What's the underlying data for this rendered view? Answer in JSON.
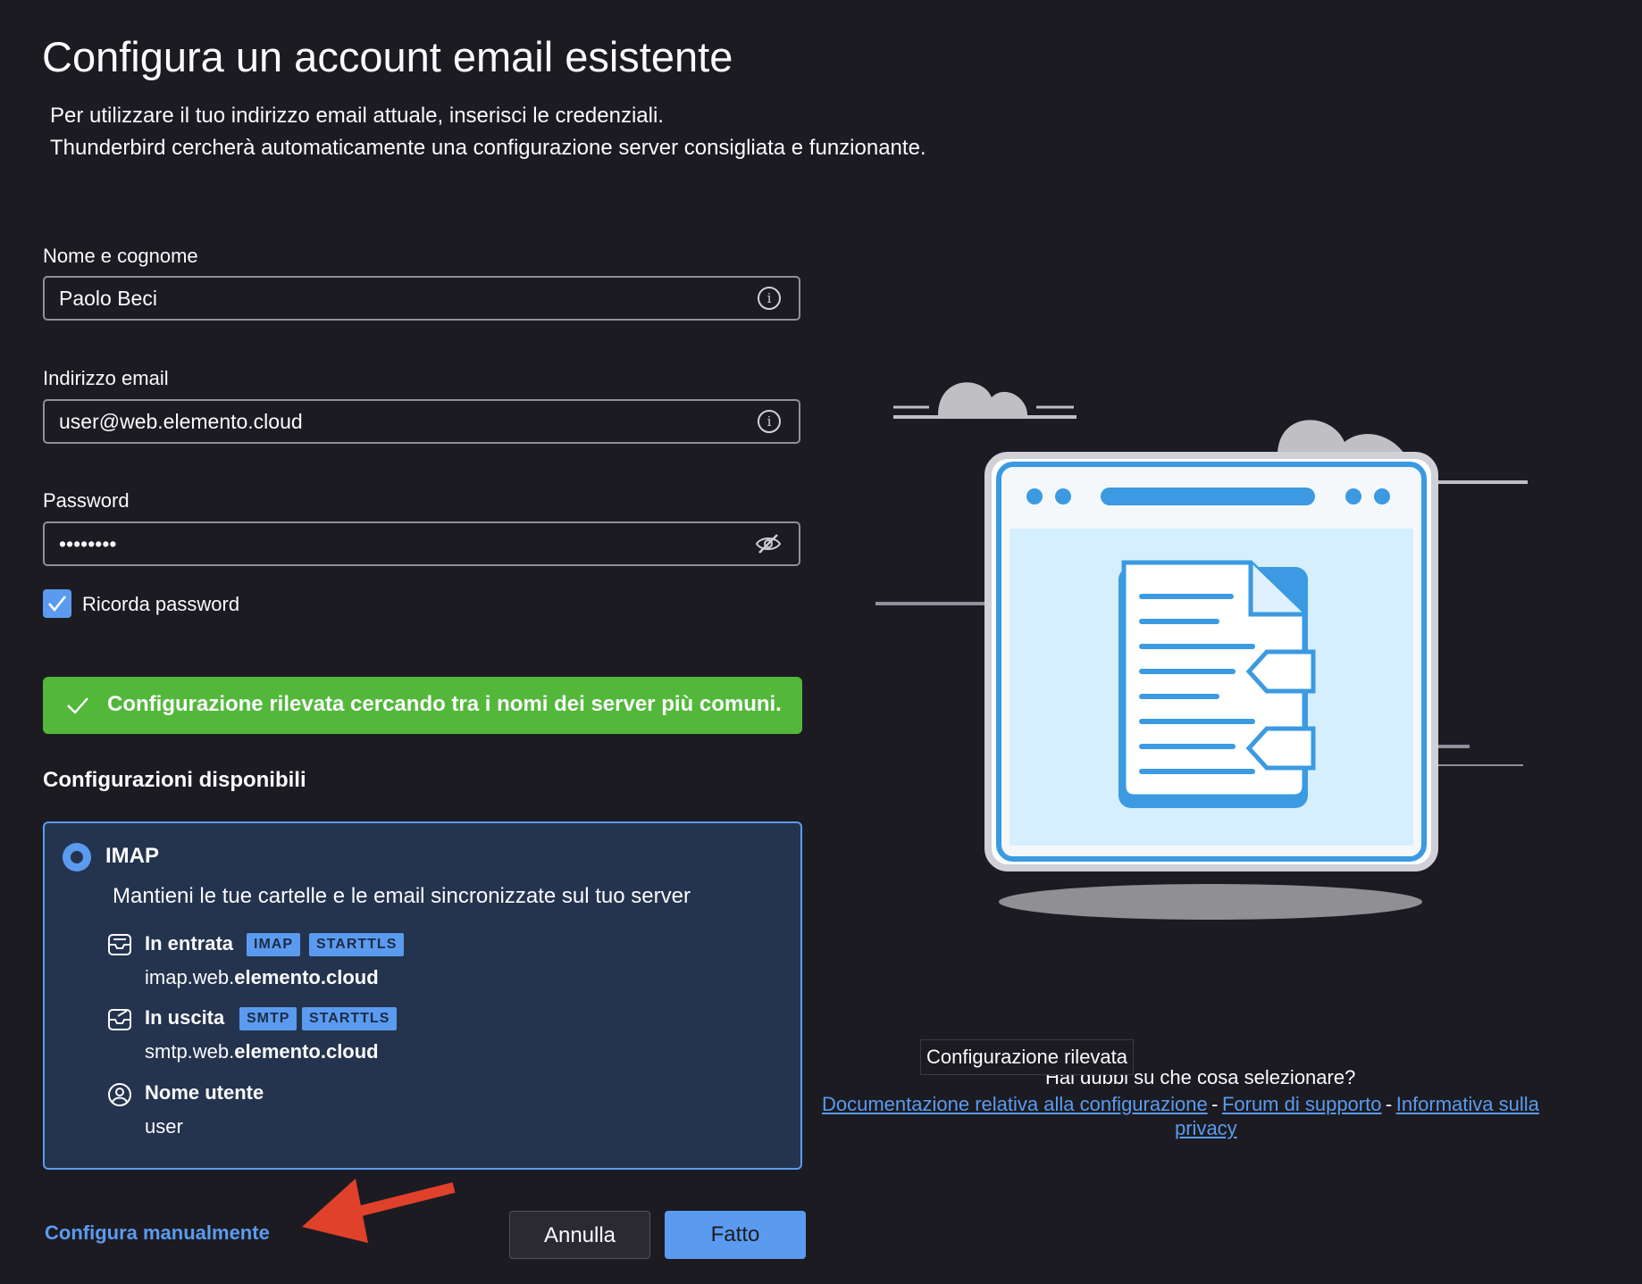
{
  "page": {
    "title": "Configura un account email esistente",
    "subtitle_line1": "Per utilizzare il tuo indirizzo email attuale, inserisci le credenziali.",
    "subtitle_line2": "Thunderbird cercherà automaticamente una configurazione server consigliata e funzionante."
  },
  "form": {
    "name_label": "Nome e cognome",
    "name_value": "Paolo Beci",
    "email_label": "Indirizzo email",
    "email_value": "user@web.elemento.cloud",
    "password_label": "Password",
    "password_value": "••••••••",
    "remember_label": "Ricorda password",
    "remember_checked": true
  },
  "status": {
    "success_message": "Configurazione rilevata cercando tra i nomi dei server più comuni.",
    "success_color": "#53b83a"
  },
  "configs": {
    "heading": "Configurazioni disponibili",
    "option": {
      "title": "IMAP",
      "description": "Mantieni le tue cartelle e le email sincronizzate sul tuo server",
      "incoming_label": "In entrata",
      "incoming_badges": [
        "IMAP",
        "STARTTLS"
      ],
      "incoming_host_prefix": "imap.web.",
      "incoming_host_domain": "elemento.cloud",
      "outgoing_label": "In uscita",
      "outgoing_badges": [
        "SMTP",
        "STARTTLS"
      ],
      "outgoing_host_prefix": "smtp.web.",
      "outgoing_host_domain": "elemento.cloud",
      "username_label": "Nome utente",
      "username_value": "user"
    }
  },
  "footer": {
    "manual_link": "Configura manualmente",
    "cancel_label": "Annulla",
    "done_label": "Fatto"
  },
  "help": {
    "tooltip": "Configurazione rilevata",
    "question": "Hai dubbi su che cosa selezionare?",
    "link_docs": "Documentazione relativa alla configurazione",
    "link_forum": "Forum di supporto",
    "link_privacy_1": "Informativa sulla",
    "link_privacy_2": "privacy",
    "separator": "-"
  },
  "colors": {
    "accent": "#5b9bef",
    "background": "#1c1b22",
    "card": "#24344e",
    "arrow": "#e0412a"
  }
}
